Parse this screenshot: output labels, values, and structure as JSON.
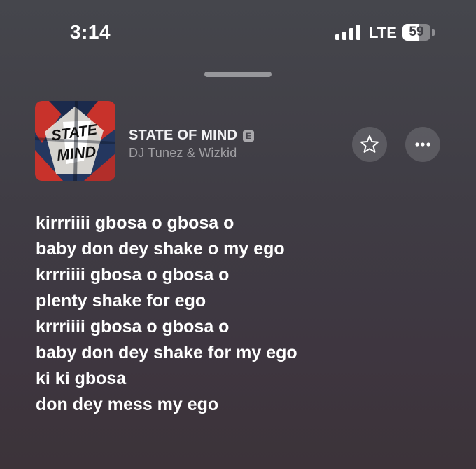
{
  "status_bar": {
    "time": "3:14",
    "network": "LTE",
    "battery": "59",
    "battery_level": 0.59,
    "signal_bars": 4
  },
  "now_playing": {
    "artwork_text": "STATE OF MIND",
    "title": "STATE OF MIND",
    "explicit_label": "E",
    "artist": "DJ Tunez & Wizkid"
  },
  "icons": {
    "favorite": "star-outline-icon",
    "more": "ellipsis-icon"
  },
  "lyrics": [
    "kirrriiii gbosa o gbosa o",
    "baby don dey shake o my ego",
    "krrriiii gbosa o gbosa o",
    "plenty shake for ego",
    "krrriiii gbosa o gbosa o",
    "baby don dey shake for my ego",
    "ki ki gbosa",
    "don dey mess my ego"
  ],
  "colors": {
    "background_top": "#45464c",
    "background_bottom": "#3c3339",
    "text": "#ffffff",
    "secondary_text": "#9a979c",
    "artwork_red": "#c8322b",
    "artwork_blue": "#24375f"
  }
}
